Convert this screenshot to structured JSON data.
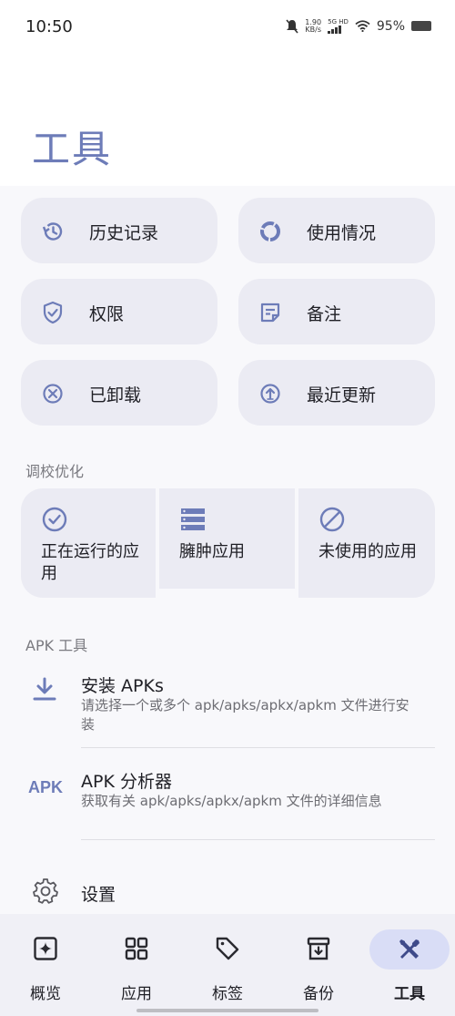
{
  "status_bar": {
    "time": "10:50",
    "speed_value": "1.90",
    "speed_unit": "KB/s",
    "network": "5G HD",
    "battery": "95%"
  },
  "header": {
    "title": "工具"
  },
  "tools": [
    {
      "label": "历史记录",
      "icon": "history-icon"
    },
    {
      "label": "使用情况",
      "icon": "donut-chart-icon"
    },
    {
      "label": "权限",
      "icon": "shield-check-icon"
    },
    {
      "label": "备注",
      "icon": "note-icon"
    },
    {
      "label": "已卸载",
      "icon": "circle-x-icon"
    },
    {
      "label": "最近更新",
      "icon": "circle-up-arrow-icon"
    }
  ],
  "optimization": {
    "title": "调校优化",
    "items": [
      {
        "label": "正在运行的应用",
        "icon": "check-circle-icon"
      },
      {
        "label": "臃肿应用",
        "icon": "stacked-list-icon"
      },
      {
        "label": "未使用的应用",
        "icon": "block-icon"
      }
    ]
  },
  "apk_tools": {
    "title": "APK 工具",
    "install": {
      "title": "安装 APKs",
      "subtitle": "请选择一个或多个 apk/apks/apkx/apkm 文件进行安装",
      "icon": "download-icon"
    },
    "analyzer": {
      "title": "APK 分析器",
      "subtitle": "获取有关 apk/apks/apkx/apkm 文件的详细信息",
      "icon_text": "APK"
    }
  },
  "settings": {
    "label": "设置",
    "icon": "gear-icon"
  },
  "bottom_nav": [
    {
      "label": "概览",
      "icon": "sparkle-icon",
      "active": false
    },
    {
      "label": "应用",
      "icon": "grid-icon",
      "active": false
    },
    {
      "label": "标签",
      "icon": "tag-icon",
      "active": false
    },
    {
      "label": "备份",
      "icon": "archive-icon",
      "active": false
    },
    {
      "label": "工具",
      "icon": "tools-icon",
      "active": true
    }
  ],
  "colors": {
    "accent": "#6d7cb8",
    "card": "#ebebf3",
    "active_pill": "#d9ddf6"
  }
}
